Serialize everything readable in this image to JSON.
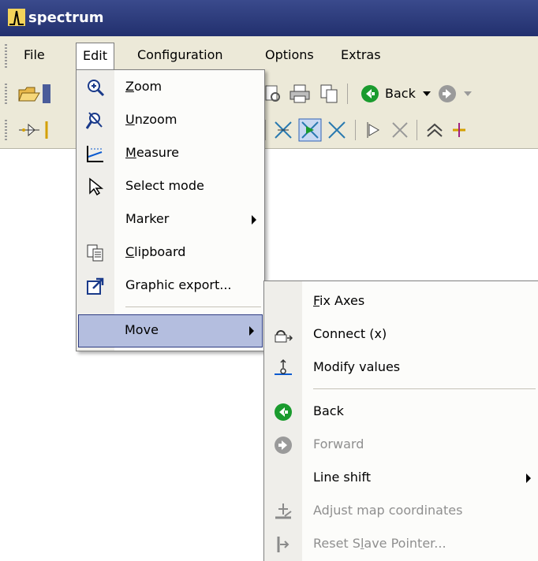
{
  "window": {
    "title": "spectrum"
  },
  "menubar": {
    "items": [
      "File",
      "Edit",
      "Configuration",
      "Options",
      "Extras"
    ]
  },
  "toolbar": {
    "back_label": "Back"
  },
  "edit_menu": {
    "items": [
      {
        "label": "Zoom",
        "icon": "zoom-in-icon"
      },
      {
        "label": "Unzoom",
        "icon": "unzoom-icon"
      },
      {
        "label": "Measure",
        "icon": "measure-icon"
      },
      {
        "label": "Select mode",
        "icon": "cursor-icon"
      },
      {
        "label": "Marker",
        "icon": "",
        "submenu": true
      },
      {
        "label": "Clipboard",
        "icon": "clipboard-icon"
      },
      {
        "label": "Graphic export...",
        "icon": "export-icon"
      },
      {
        "label": "Move",
        "icon": "",
        "submenu": true,
        "highlighted": true
      }
    ]
  },
  "move_submenu": {
    "items": [
      {
        "label": "Fix Axes",
        "icon": "",
        "disabled": false
      },
      {
        "label": "Connect (x)",
        "icon": "connect-icon",
        "disabled": false
      },
      {
        "label": "Modify values",
        "icon": "modify-values-icon",
        "disabled": false
      },
      {
        "label": "Back",
        "icon": "back-arrow-icon",
        "disabled": false
      },
      {
        "label": "Forward",
        "icon": "forward-arrow-icon",
        "disabled": true
      },
      {
        "label": "Line shift",
        "icon": "",
        "submenu": true,
        "disabled": false
      },
      {
        "label": "Adjust map coordinates",
        "icon": "adjust-map-icon",
        "disabled": true
      },
      {
        "label": "Reset Slave Pointer...",
        "icon": "reset-pointer-icon",
        "disabled": true
      }
    ]
  },
  "colors": {
    "title_bar": "#2a3876",
    "highlight": "#b4bedf",
    "highlight_border": "#2e3c82",
    "back_green": "#1a9b2e"
  }
}
